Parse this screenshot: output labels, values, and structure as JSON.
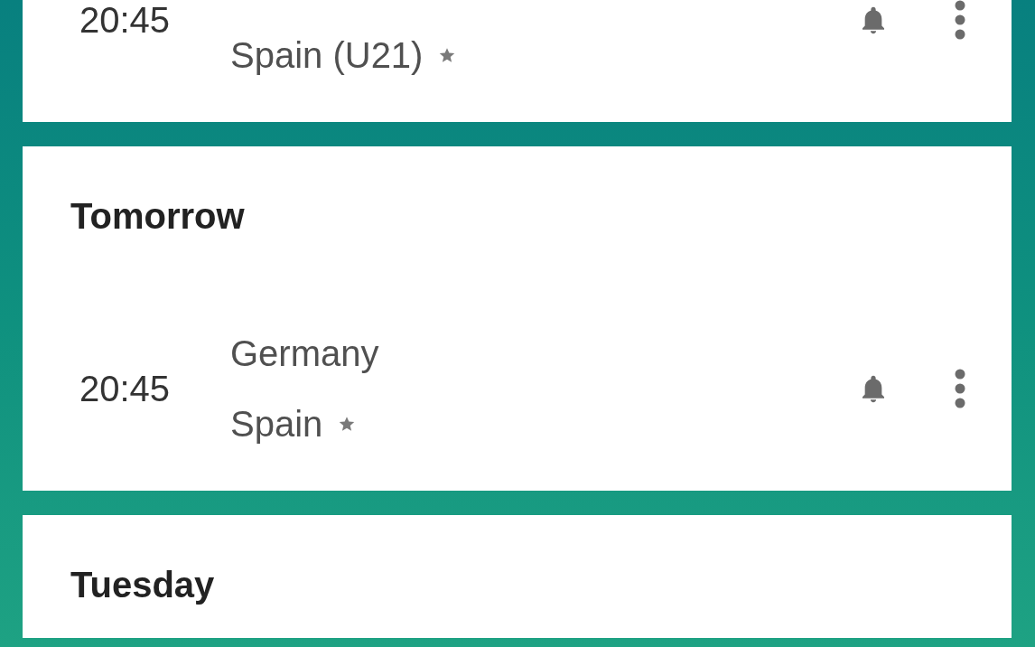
{
  "days": [
    {
      "matches": [
        {
          "time": "20:45",
          "teams": [
            {
              "name": "Spain (U21)",
              "favorite": true
            }
          ]
        }
      ]
    },
    {
      "title": "Tomorrow",
      "matches": [
        {
          "time": "20:45",
          "teams": [
            {
              "name": "Germany",
              "favorite": false
            },
            {
              "name": "Spain",
              "favorite": true
            }
          ]
        }
      ]
    },
    {
      "title": "Tuesday"
    }
  ]
}
